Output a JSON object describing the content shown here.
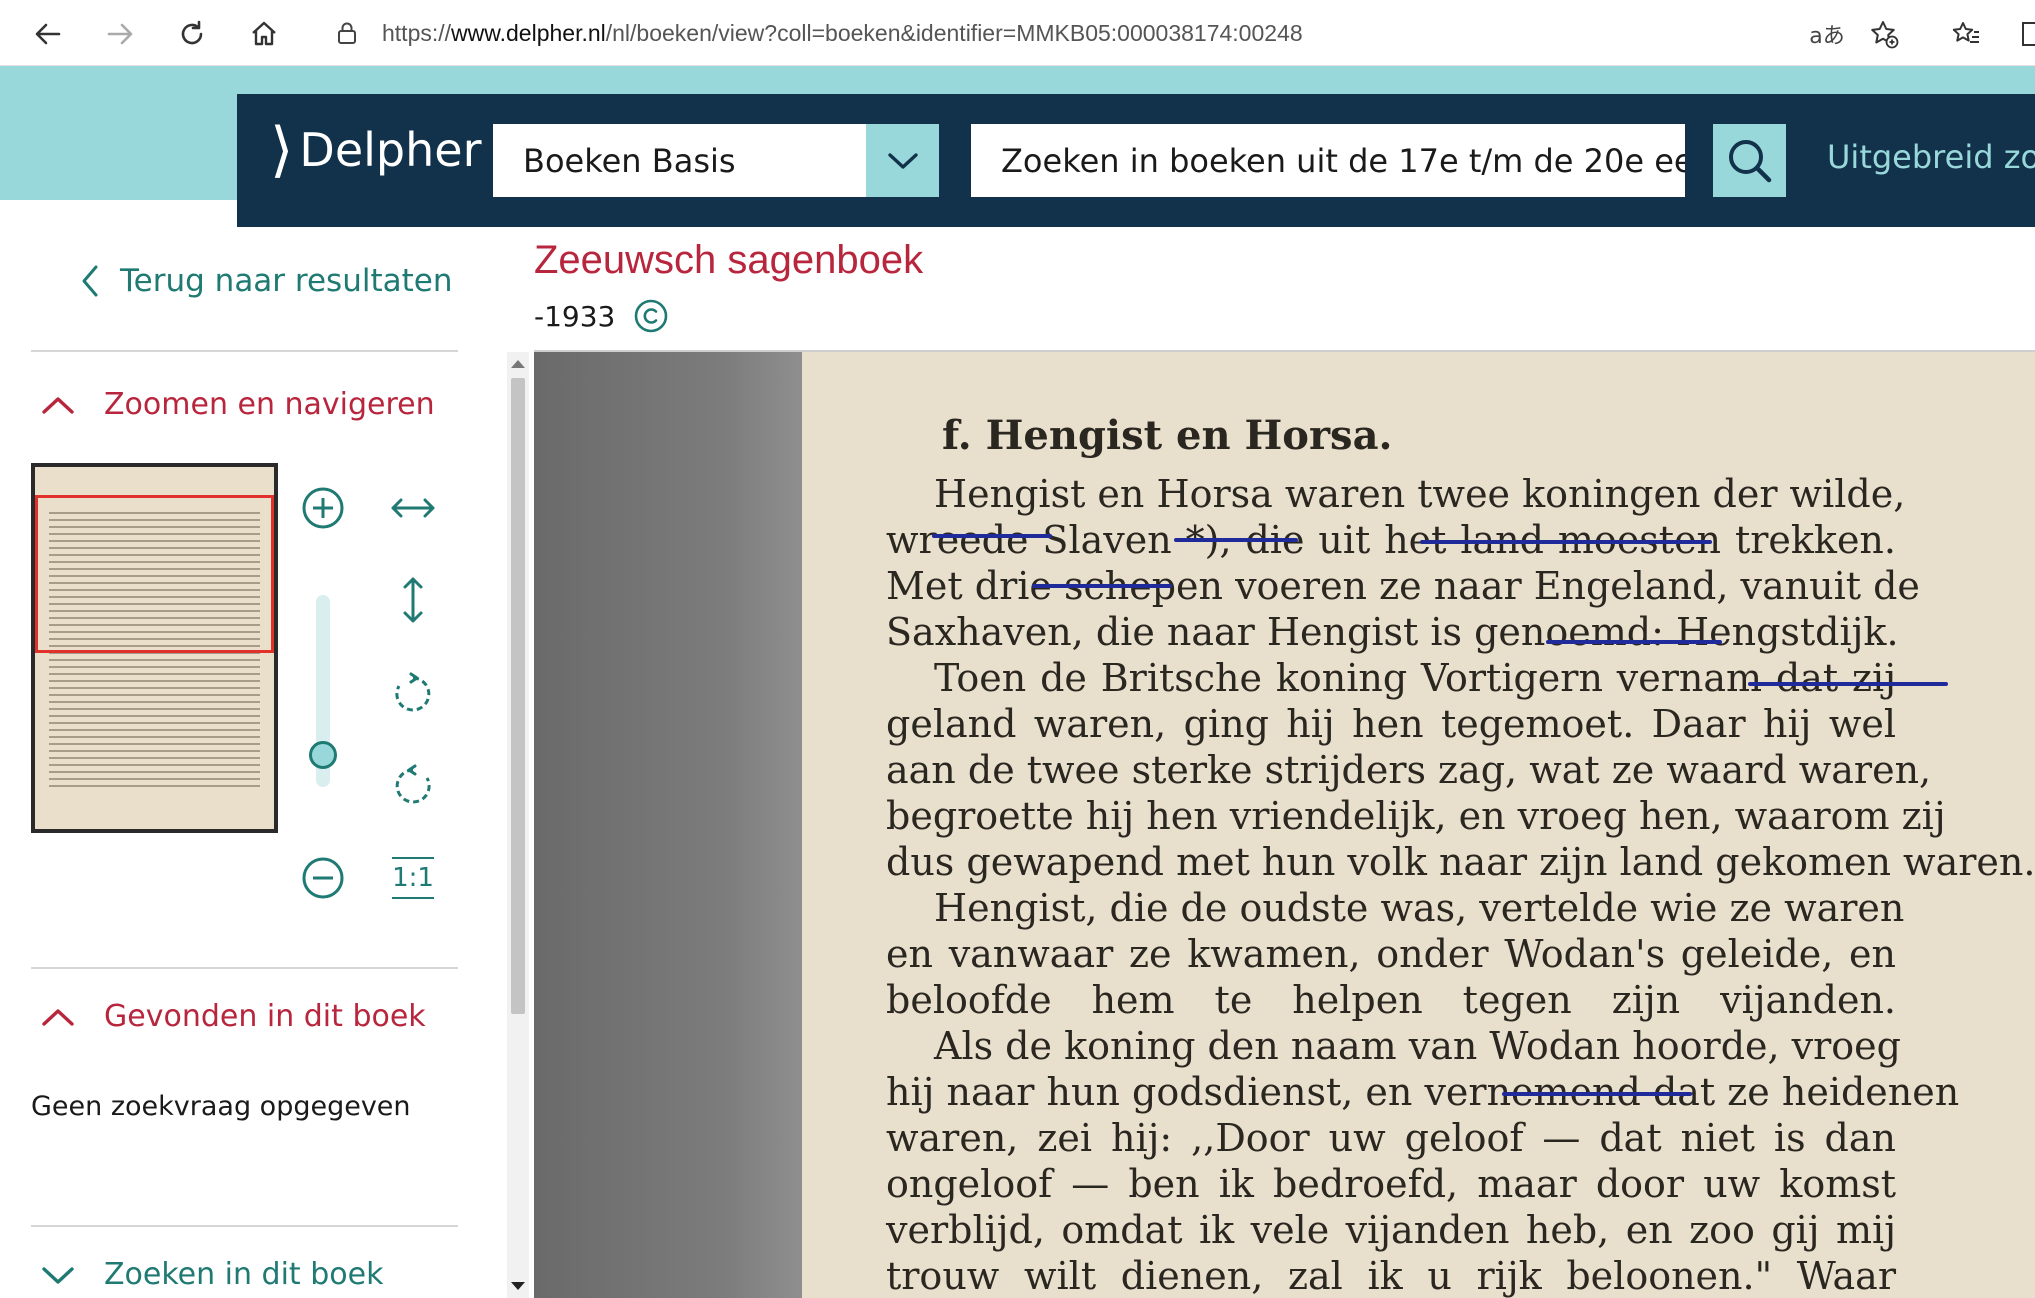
{
  "browser": {
    "url_prefix": "https://",
    "url_domain": "www.delpher.nl",
    "url_path": "/nl/boeken/view?coll=boeken&identifier=MMKB05:000038174:00248",
    "read_aloud_label": "aあ"
  },
  "header": {
    "logo_text": "Delpher",
    "collection_label": "Boeken Basis",
    "search_placeholder": "Zoeken in boeken uit de 17e t/m de 20e ee...",
    "advanced_label": "Uitgebreid zoe"
  },
  "sidebar": {
    "back_label": "Terug naar resultaten",
    "zoom_section_label": "Zoomen en navigeren",
    "found_section_label": "Gevonden in dit boek",
    "no_query_text": "Geen zoekvraag opgegeven",
    "search_section_label": "Zoeken in dit boek",
    "zoom_reset_label": "1:1"
  },
  "book": {
    "title": "Zeeuwsch sagenboek",
    "year": "-1933"
  },
  "page": {
    "heading": "f.   Hengist en Horsa.",
    "lines": [
      "Hengist en Horsa waren twee koningen der wilde,",
      "wreede Slaven *), die uit het land moesten trekken.",
      "Met drie schepen voeren ze naar Engeland, vanuit de",
      "Saxhaven, die naar Hengist is genoemd: Hengstdijk.",
      "Toen de Britsche koning Vortigern vernam dat zij",
      "geland waren, ging hij hen tegemoet. Daar hij wel",
      "aan de twee sterke strijders zag, wat ze waard waren,",
      "begroette hij hen vriendelijk, en vroeg hen, waarom zij",
      "dus gewapend met hun volk naar zijn land gekomen waren.",
      "Hengist, die de oudste was, vertelde wie ze waren",
      "en vanwaar ze kwamen, onder Wodan's geleide, en",
      "beloofde hem te helpen tegen zijn vijanden.",
      "Als de koning den naam van Wodan hoorde, vroeg",
      "hij naar hun godsdienst, en vernemend dat ze heidenen",
      "waren, zei hij: ,,Door uw geloof — dat niet is dan",
      "ongeloof — ben ik bedroefd, maar door uw komst",
      "verblijd, omdat ik vele vijanden heb, en zoo gij mij",
      "trouw wilt dienen, zal ik u rijk beloonen.\" Waar"
    ]
  },
  "colors": {
    "teal": "#98d8da",
    "navy": "#11324a",
    "crimson": "#b8263d",
    "dark_teal": "#1f7a73",
    "paper": "#e8dfcc",
    "ink_underline": "#1f2b9a"
  }
}
